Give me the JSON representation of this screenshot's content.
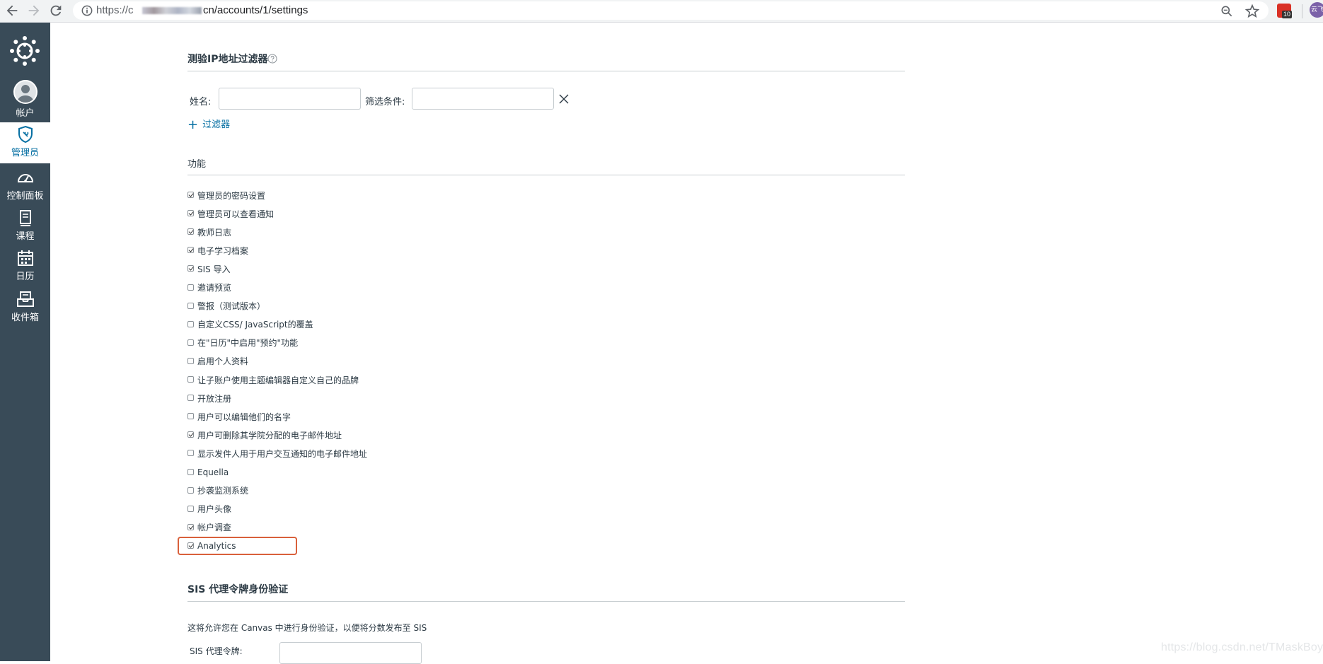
{
  "browser": {
    "url_scheme": "https://c",
    "url_rest": "cn/accounts/1/settings",
    "extension_badge": "10",
    "profile_label": "云飞"
  },
  "sidebar": {
    "items": [
      {
        "label": "帐户",
        "icon": "user-avatar-icon"
      },
      {
        "label": "管理员",
        "icon": "admin-shield-icon",
        "active": true
      },
      {
        "label": "控制面板",
        "icon": "dashboard-gauge-icon"
      },
      {
        "label": "课程",
        "icon": "courses-book-icon"
      },
      {
        "label": "日历",
        "icon": "calendar-icon"
      },
      {
        "label": "收件箱",
        "icon": "inbox-icon"
      }
    ]
  },
  "ip_filter": {
    "title": "测验IP地址过滤器",
    "name_label": "姓名:",
    "name_value": "",
    "condition_label": "筛选条件:",
    "condition_value": "",
    "add_label": "过滤器"
  },
  "features": {
    "title": "功能",
    "items": [
      {
        "label": "管理员的密码设置",
        "checked": true
      },
      {
        "label": "管理员可以查看通知",
        "checked": true
      },
      {
        "label": "教师日志",
        "checked": true
      },
      {
        "label": "电子学习档案",
        "checked": true
      },
      {
        "label": "SIS 导入",
        "checked": true
      },
      {
        "label": "邀请预览",
        "checked": false
      },
      {
        "label": "警报（测试版本）",
        "checked": false
      },
      {
        "label": "自定义CSS/ JavaScript的覆盖",
        "checked": false
      },
      {
        "label": "在\"日历\"中启用\"预约\"功能",
        "checked": false
      },
      {
        "label": "启用个人资料",
        "checked": false
      },
      {
        "label": "让子账户使用主题编辑器自定义自己的品牌",
        "checked": false
      },
      {
        "label": "开放注册",
        "checked": false
      },
      {
        "label": "用户可以编辑他们的名字",
        "checked": false
      },
      {
        "label": "用户可删除其学院分配的电子邮件地址",
        "checked": true
      },
      {
        "label": "显示发件人用于用户交互通知的电子邮件地址",
        "checked": false
      },
      {
        "label": "Equella",
        "checked": false
      },
      {
        "label": "抄袭监测系统",
        "checked": false
      },
      {
        "label": "用户头像",
        "checked": false
      },
      {
        "label": "帐户调查",
        "checked": true
      },
      {
        "label": "Analytics",
        "checked": true,
        "highlighted": true
      }
    ]
  },
  "sis_token": {
    "title": "SIS 代理令牌身份验证",
    "description": "这将允许您在 Canvas 中进行身份验证，以便将分数发布至 SIS",
    "token_label": "SIS 代理令牌:",
    "token_value": ""
  },
  "watermark": "https://blog.csdn.net/TMaskBoy",
  "colors": {
    "sidebar_bg": "#394b58",
    "link": "#0770a3",
    "highlight": "#d9603b"
  }
}
